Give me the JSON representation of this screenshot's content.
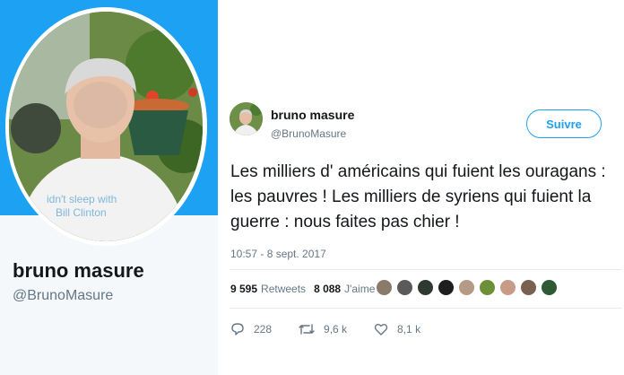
{
  "profile": {
    "name": "bruno masure",
    "handle": "@BrunoMasure"
  },
  "tweet": {
    "author_name": "bruno masure",
    "author_handle": "@BrunoMasure",
    "follow_label": "Suivre",
    "text": "Les milliers d' américains qui fuient les ouragans : les pauvres ! Les milliers de syriens qui fuient la guerre : nous faites pas chier !",
    "timestamp": "10:57 - 8 sept. 2017",
    "retweets_count": "9 595",
    "retweets_label": "Retweets",
    "likes_count": "8 088",
    "likes_label": "J'aime",
    "reply_count": "228",
    "retweet_action_count": "9,6 k",
    "like_action_count": "8,1 k"
  },
  "colors": {
    "accent": "#1da1f2",
    "text_primary": "#14171a",
    "text_secondary": "#657786"
  },
  "icons": {
    "reply": "reply-icon",
    "retweet": "retweet-icon",
    "like": "heart-icon"
  }
}
